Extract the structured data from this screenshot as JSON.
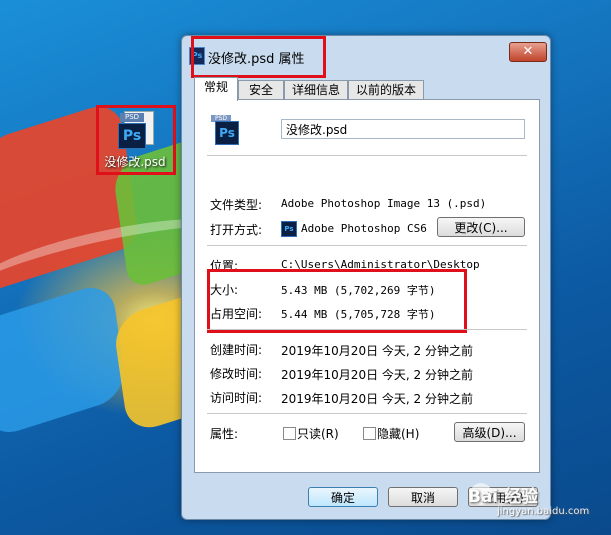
{
  "desktop": {
    "icon_label": "没修改.psd",
    "icon_tag": "PSD",
    "icon_ps": "Ps"
  },
  "window": {
    "title": "没修改.psd 属性",
    "close_glyph": "✕"
  },
  "tabs": [
    {
      "label": "常规",
      "active": true
    },
    {
      "label": "安全"
    },
    {
      "label": "详细信息"
    },
    {
      "label": "以前的版本"
    }
  ],
  "general": {
    "file_tag": "PSD",
    "file_ps": "Ps",
    "file_name": "没修改.psd",
    "file_type_label": "文件类型:",
    "file_type_value": "Adobe Photoshop Image 13 (.psd)",
    "open_with_label": "打开方式:",
    "open_with_value": "Adobe Photoshop CS6",
    "change_button": "更改(C)...",
    "location_label": "位置:",
    "location_value": "C:\\Users\\Administrator\\Desktop",
    "size_label": "大小:",
    "size_value": "5.43 MB (5,702,269 字节)",
    "size_on_disk_label": "占用空间:",
    "size_on_disk_value": "5.44 MB (5,705,728 字节)",
    "created_label": "创建时间:",
    "created_value": "2019年10月20日 今天, 2 分钟之前",
    "modified_label": "修改时间:",
    "modified_value": "2019年10月20日 今天, 2 分钟之前",
    "accessed_label": "访问时间:",
    "accessed_value": "2019年10月20日 今天, 2 分钟之前",
    "attributes_label": "属性:",
    "readonly_label": "只读(R)",
    "hidden_label": "隐藏(H)",
    "advanced_button": "高级(D)..."
  },
  "footer": {
    "ok": "确定",
    "cancel": "取消",
    "apply": "应用(A)"
  },
  "watermark": {
    "text": "Bai 经验",
    "url": "jingyan.baidu.com"
  }
}
